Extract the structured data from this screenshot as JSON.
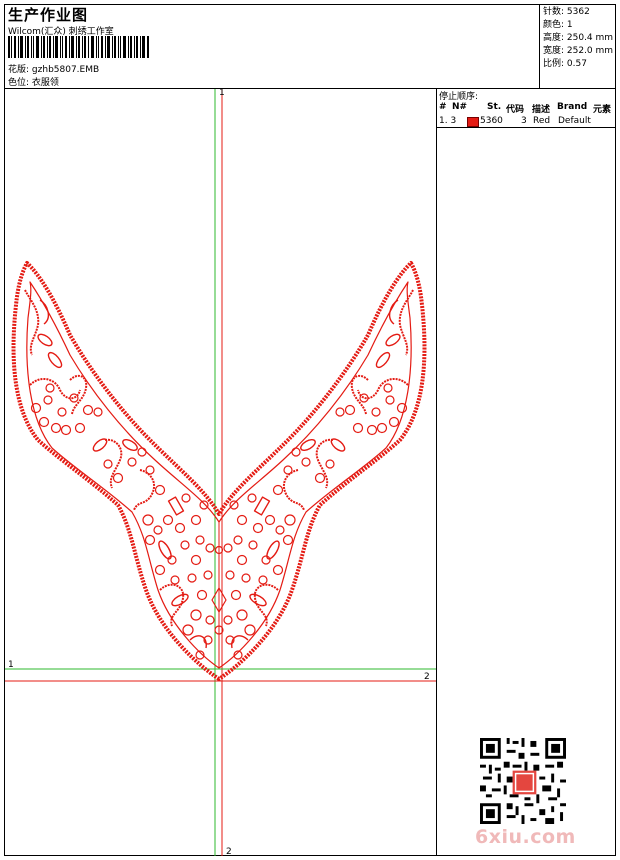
{
  "header": {
    "title": "生产作业图",
    "studio": "Wilcom(汇众) 刺绣工作室",
    "design_label": "花版:",
    "design_file": "gzhb5807.EMB",
    "position_label": "色位:",
    "position_value": "衣服领"
  },
  "stats": {
    "stitches": "针数: 5362",
    "colors": "颜色: 1",
    "height": "高度: 250.4 mm",
    "width": "宽度: 252.0 mm",
    "scale": "比例: 0.57"
  },
  "stop_sequence": {
    "title": "停止顺序:",
    "headers": [
      "#",
      "N#",
      "St.",
      "代码",
      "描述",
      "Brand",
      "元素"
    ],
    "rows": [
      {
        "index": "1. 3",
        "stitches": "5360",
        "code": "3",
        "desc": "Red",
        "brand": "Default"
      }
    ]
  },
  "axes": {
    "green_v_top": "1",
    "green_h_left": "1",
    "red_h_right": "2",
    "red_v_bottom": "2"
  },
  "colors": {
    "thread": "#e41b13",
    "green_axis": "#2db82d",
    "red_axis": "#e41b13"
  },
  "watermark": "6xiu.com"
}
